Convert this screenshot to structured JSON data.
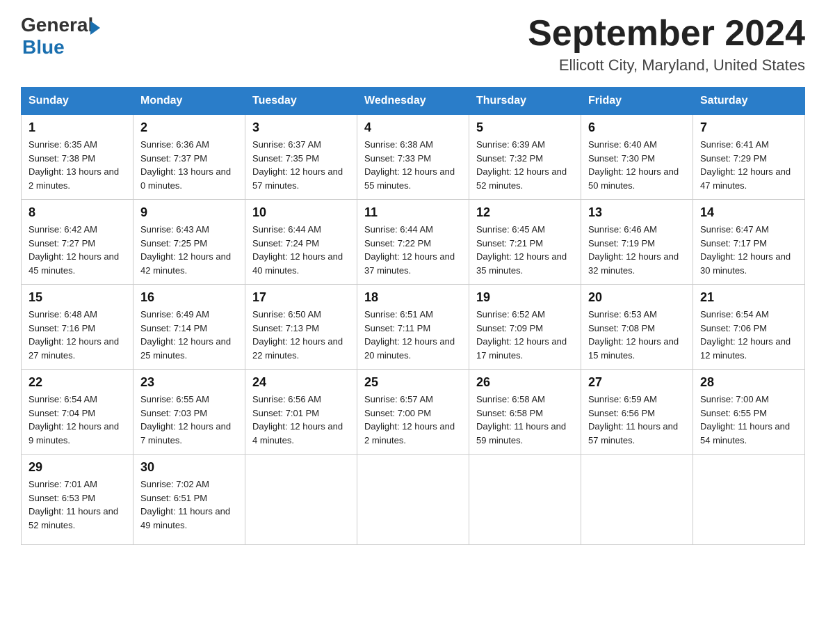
{
  "header": {
    "logo_general": "General",
    "logo_blue": "Blue",
    "month_year": "September 2024",
    "location": "Ellicott City, Maryland, United States"
  },
  "days_of_week": [
    "Sunday",
    "Monday",
    "Tuesday",
    "Wednesday",
    "Thursday",
    "Friday",
    "Saturday"
  ],
  "weeks": [
    [
      {
        "day": "1",
        "sunrise": "6:35 AM",
        "sunset": "7:38 PM",
        "daylight": "13 hours and 2 minutes."
      },
      {
        "day": "2",
        "sunrise": "6:36 AM",
        "sunset": "7:37 PM",
        "daylight": "13 hours and 0 minutes."
      },
      {
        "day": "3",
        "sunrise": "6:37 AM",
        "sunset": "7:35 PM",
        "daylight": "12 hours and 57 minutes."
      },
      {
        "day": "4",
        "sunrise": "6:38 AM",
        "sunset": "7:33 PM",
        "daylight": "12 hours and 55 minutes."
      },
      {
        "day": "5",
        "sunrise": "6:39 AM",
        "sunset": "7:32 PM",
        "daylight": "12 hours and 52 minutes."
      },
      {
        "day": "6",
        "sunrise": "6:40 AM",
        "sunset": "7:30 PM",
        "daylight": "12 hours and 50 minutes."
      },
      {
        "day": "7",
        "sunrise": "6:41 AM",
        "sunset": "7:29 PM",
        "daylight": "12 hours and 47 minutes."
      }
    ],
    [
      {
        "day": "8",
        "sunrise": "6:42 AM",
        "sunset": "7:27 PM",
        "daylight": "12 hours and 45 minutes."
      },
      {
        "day": "9",
        "sunrise": "6:43 AM",
        "sunset": "7:25 PM",
        "daylight": "12 hours and 42 minutes."
      },
      {
        "day": "10",
        "sunrise": "6:44 AM",
        "sunset": "7:24 PM",
        "daylight": "12 hours and 40 minutes."
      },
      {
        "day": "11",
        "sunrise": "6:44 AM",
        "sunset": "7:22 PM",
        "daylight": "12 hours and 37 minutes."
      },
      {
        "day": "12",
        "sunrise": "6:45 AM",
        "sunset": "7:21 PM",
        "daylight": "12 hours and 35 minutes."
      },
      {
        "day": "13",
        "sunrise": "6:46 AM",
        "sunset": "7:19 PM",
        "daylight": "12 hours and 32 minutes."
      },
      {
        "day": "14",
        "sunrise": "6:47 AM",
        "sunset": "7:17 PM",
        "daylight": "12 hours and 30 minutes."
      }
    ],
    [
      {
        "day": "15",
        "sunrise": "6:48 AM",
        "sunset": "7:16 PM",
        "daylight": "12 hours and 27 minutes."
      },
      {
        "day": "16",
        "sunrise": "6:49 AM",
        "sunset": "7:14 PM",
        "daylight": "12 hours and 25 minutes."
      },
      {
        "day": "17",
        "sunrise": "6:50 AM",
        "sunset": "7:13 PM",
        "daylight": "12 hours and 22 minutes."
      },
      {
        "day": "18",
        "sunrise": "6:51 AM",
        "sunset": "7:11 PM",
        "daylight": "12 hours and 20 minutes."
      },
      {
        "day": "19",
        "sunrise": "6:52 AM",
        "sunset": "7:09 PM",
        "daylight": "12 hours and 17 minutes."
      },
      {
        "day": "20",
        "sunrise": "6:53 AM",
        "sunset": "7:08 PM",
        "daylight": "12 hours and 15 minutes."
      },
      {
        "day": "21",
        "sunrise": "6:54 AM",
        "sunset": "7:06 PM",
        "daylight": "12 hours and 12 minutes."
      }
    ],
    [
      {
        "day": "22",
        "sunrise": "6:54 AM",
        "sunset": "7:04 PM",
        "daylight": "12 hours and 9 minutes."
      },
      {
        "day": "23",
        "sunrise": "6:55 AM",
        "sunset": "7:03 PM",
        "daylight": "12 hours and 7 minutes."
      },
      {
        "day": "24",
        "sunrise": "6:56 AM",
        "sunset": "7:01 PM",
        "daylight": "12 hours and 4 minutes."
      },
      {
        "day": "25",
        "sunrise": "6:57 AM",
        "sunset": "7:00 PM",
        "daylight": "12 hours and 2 minutes."
      },
      {
        "day": "26",
        "sunrise": "6:58 AM",
        "sunset": "6:58 PM",
        "daylight": "11 hours and 59 minutes."
      },
      {
        "day": "27",
        "sunrise": "6:59 AM",
        "sunset": "6:56 PM",
        "daylight": "11 hours and 57 minutes."
      },
      {
        "day": "28",
        "sunrise": "7:00 AM",
        "sunset": "6:55 PM",
        "daylight": "11 hours and 54 minutes."
      }
    ],
    [
      {
        "day": "29",
        "sunrise": "7:01 AM",
        "sunset": "6:53 PM",
        "daylight": "11 hours and 52 minutes."
      },
      {
        "day": "30",
        "sunrise": "7:02 AM",
        "sunset": "6:51 PM",
        "daylight": "11 hours and 49 minutes."
      },
      {
        "day": "",
        "sunrise": "",
        "sunset": "",
        "daylight": ""
      },
      {
        "day": "",
        "sunrise": "",
        "sunset": "",
        "daylight": ""
      },
      {
        "day": "",
        "sunrise": "",
        "sunset": "",
        "daylight": ""
      },
      {
        "day": "",
        "sunrise": "",
        "sunset": "",
        "daylight": ""
      },
      {
        "day": "",
        "sunrise": "",
        "sunset": "",
        "daylight": ""
      }
    ]
  ]
}
